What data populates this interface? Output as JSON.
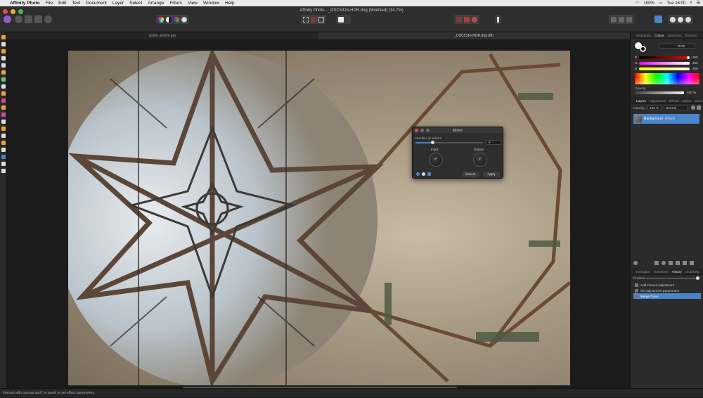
{
  "menubar": {
    "app_name": "Affinity Photo",
    "items": [
      "File",
      "Edit",
      "Text",
      "Document",
      "Layer",
      "Select",
      "Arrange",
      "Filters",
      "View",
      "Window",
      "Help"
    ],
    "battery": "100%",
    "time": "Tue 16:00"
  },
  "window": {
    "title": "Affinity Photo - _DSC5316-HDR.dng (Modified) (34.7%)"
  },
  "tabs": [
    {
      "label": "pathe_before.jpg",
      "active": false
    },
    {
      "label": "_DSC5316-HDR.dng (M)",
      "active": true
    }
  ],
  "right_panel": {
    "top_tabs": [
      "Histogram",
      "Colour",
      "Swatches",
      "Brushes"
    ],
    "active_top_tab": "Colour",
    "colour_mode": "RGB",
    "r_value": "255",
    "g_value": "255",
    "b_value": "255",
    "opacity_label": "Opacity",
    "opacity_value": "100 %",
    "layer_tabs": [
      "Layers",
      "Adjustment",
      "Effects",
      "Styles",
      "Stock"
    ],
    "active_layer_tab": "Layers",
    "layer_opacity_label": "Opacity:",
    "layer_opacity_value": "100 %",
    "blend_mode": "Normal",
    "layer_name": "Background",
    "layer_type": "(Pixel)",
    "bottom_tabs": [
      "Navigator",
      "Transform",
      "History",
      "Channels"
    ],
    "active_bottom_tab": "History",
    "position_label": "Position:",
    "history": [
      {
        "label": "Add Curves Adjustment",
        "selected": false
      },
      {
        "label": "Set adjustment parameters",
        "selected": false
      },
      {
        "label": "Merge Down",
        "selected": true
      }
    ]
  },
  "dialog": {
    "title": "Mirror",
    "mirrors_label": "Number of mirrors",
    "mirrors_value": "8",
    "mirrors_fraction": 0.25,
    "input_label": "Input",
    "input_value": "0°",
    "output_label": "Output",
    "output_value": "0°",
    "cancel_label": "Cancel",
    "apply_label": "Apply"
  },
  "status": {
    "text": "Interact with canvas and / or panel to set effect parameters."
  },
  "colors": {
    "accent": "#4a84c9",
    "close": "#e04d46",
    "minimize": "#e0b33c",
    "maximize": "#4cb94a"
  }
}
